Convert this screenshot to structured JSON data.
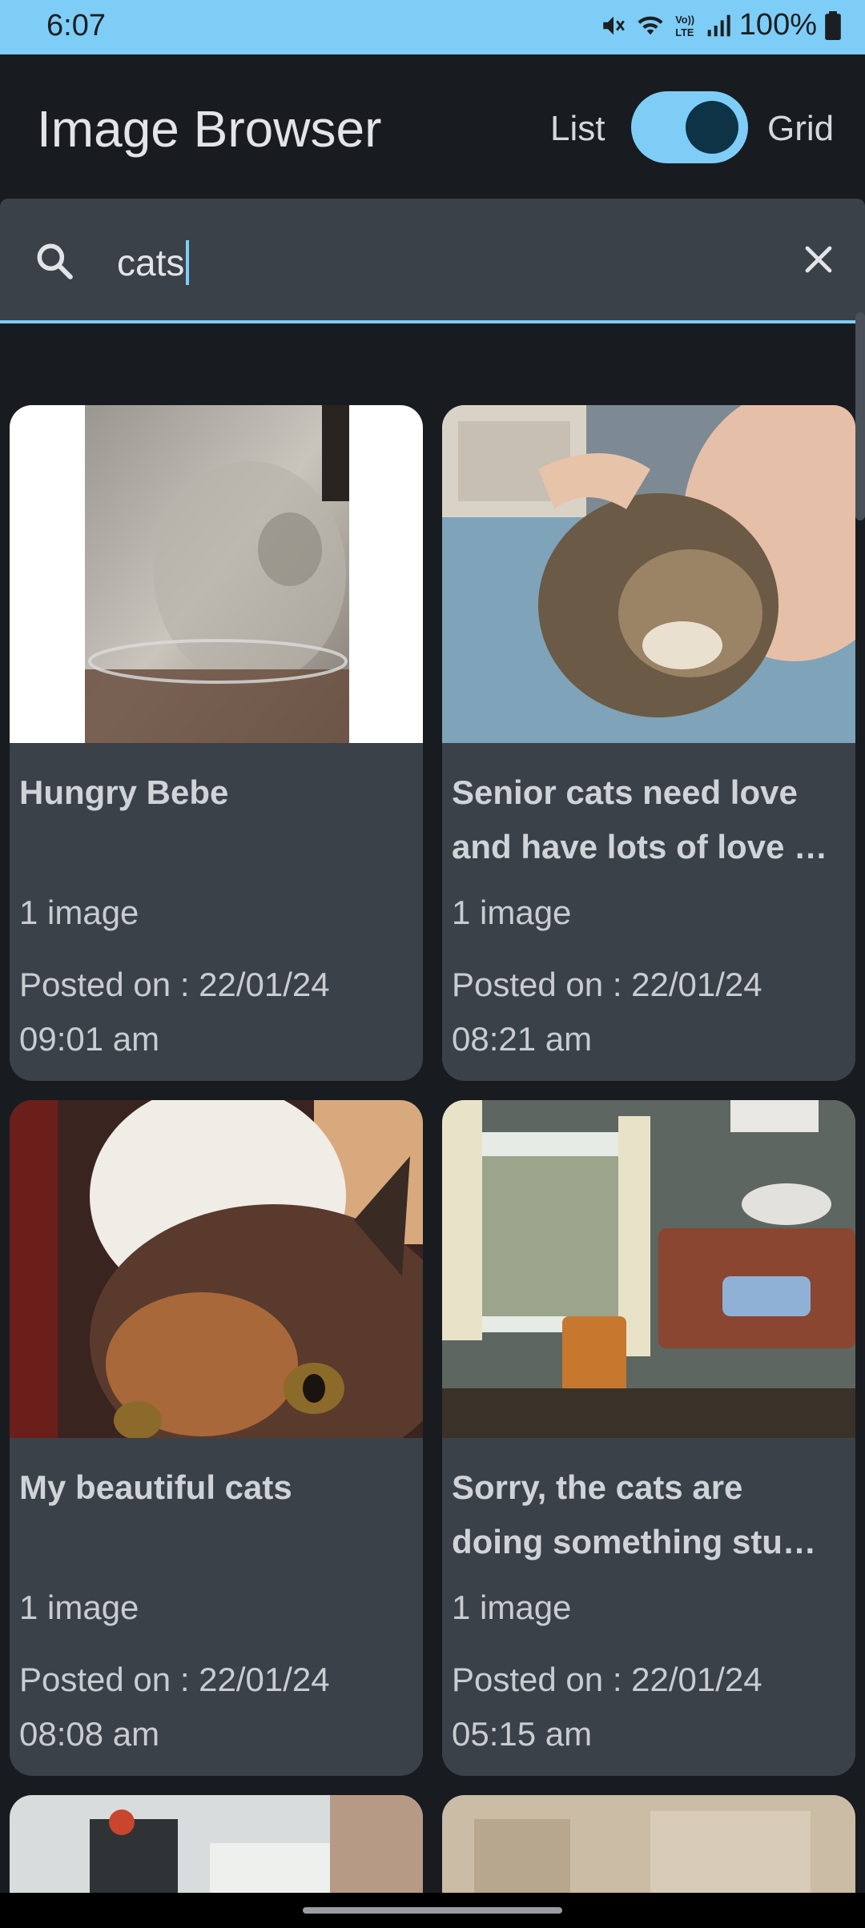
{
  "status": {
    "time": "6:07",
    "battery": "100%"
  },
  "app_bar": {
    "title": "Image Browser",
    "toggle_left": "List",
    "toggle_right": "Grid",
    "toggle_on": true
  },
  "search": {
    "value": "cats"
  },
  "cards": [
    {
      "title": "Hungry Bebe",
      "title_line2": "",
      "count": "1 image",
      "date_line1": "Posted on : 22/01/24",
      "date_line2": "09:01 am"
    },
    {
      "title": "Senior cats need love",
      "title_line2": "and have lots of love …",
      "count": "1 image",
      "date_line1": "Posted on : 22/01/24",
      "date_line2": "08:21 am"
    },
    {
      "title": "My beautiful cats",
      "title_line2": "",
      "count": "1 image",
      "date_line1": "Posted on : 22/01/24",
      "date_line2": "08:08 am"
    },
    {
      "title": "Sorry, the cats are",
      "title_line2": "doing something stu…",
      "count": "1 image",
      "date_line1": "Posted on : 22/01/24",
      "date_line2": "05:15 am"
    }
  ],
  "colors": {
    "accent": "#7ecdf7",
    "surface": "#3b4148",
    "background": "#181c20"
  }
}
